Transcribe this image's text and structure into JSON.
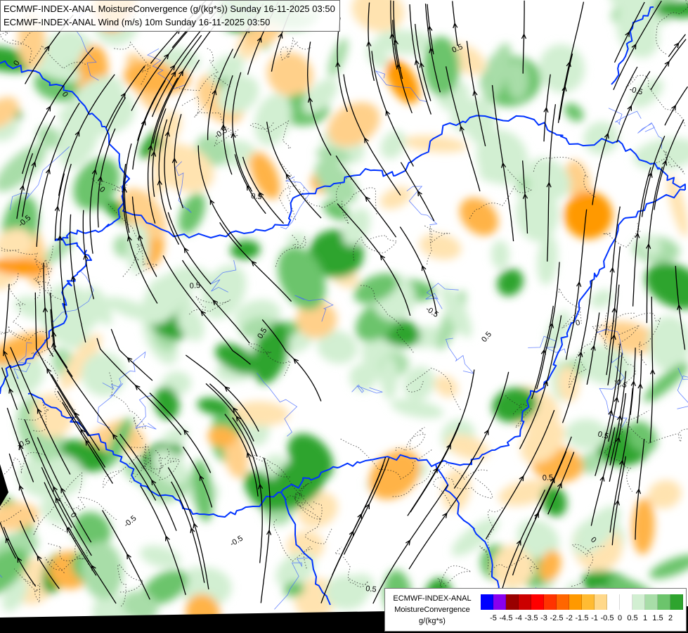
{
  "header": {
    "title_line1": "ECMWF-INDEX-ANAL MoistureConvergence (g/(kg*s)) Sunday 16-11-2025 03:50",
    "title_line2": "ECMWF-INDEX-ANAL Wind (m/s) 10m Sunday 16-11-2025 03:50"
  },
  "legend": {
    "label_line1": "ECMWF-INDEX-ANAL",
    "label_line2": "MoistureConvergence",
    "label_line3": "g/(kg*s)",
    "classes": [
      {
        "color": "#0000ff"
      },
      {
        "color": "#8800ee"
      },
      {
        "color": "#990000"
      },
      {
        "color": "#cc0000"
      },
      {
        "color": "#ff0000"
      },
      {
        "color": "#ff3300"
      },
      {
        "color": "#ff6600"
      },
      {
        "color": "#ff9900"
      },
      {
        "color": "#ffbb33"
      },
      {
        "color": "#ffd88a"
      },
      {
        "color": "#ffffff"
      },
      {
        "color": "#ffffff"
      },
      {
        "color": "#d2efd2"
      },
      {
        "color": "#a8dda8"
      },
      {
        "color": "#6cc46c"
      },
      {
        "color": "#2ea42e"
      }
    ],
    "ticks": [
      "-5",
      "-4.5",
      "-4",
      "-3.5",
      "-3",
      "-2.5",
      "-2",
      "-1.5",
      "-1",
      "-0.5",
      "0",
      "0.5",
      "1",
      "1.5",
      "2"
    ]
  },
  "map": {
    "contour_labels": [
      "0",
      "0.5",
      "-0.5",
      "0",
      "-0.5",
      "0.5",
      "0",
      "-0.5",
      "0.5",
      "-0.5",
      "0.5",
      "0",
      "-0.5",
      "0.5",
      "-0.5",
      "0.5",
      "0",
      "-0.5",
      "0.5",
      "0",
      "-0.5",
      "0.5"
    ],
    "colors": {
      "border": "#0033ff",
      "river": "#4466ff",
      "streamline": "#000000",
      "background": "#ffffff"
    }
  }
}
